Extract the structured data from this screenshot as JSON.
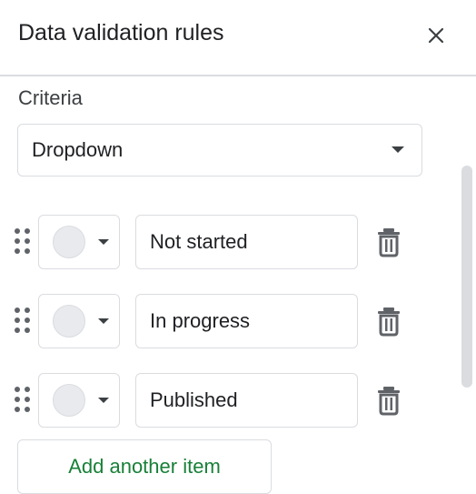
{
  "panel": {
    "title": "Data validation rules",
    "close_icon": "close-icon"
  },
  "criteria": {
    "label": "Criteria",
    "selected": "Dropdown",
    "caret_icon": "caret-down-icon"
  },
  "items": [
    {
      "value": "Not started",
      "color": "#e8eaed"
    },
    {
      "value": "In progress",
      "color": "#e8eaed"
    },
    {
      "value": "Published",
      "color": "#e8eaed"
    }
  ],
  "add_item": {
    "label": "Add another item"
  },
  "colors": {
    "accent": "#188038",
    "border": "#dadce0",
    "icon": "#5f6368"
  }
}
